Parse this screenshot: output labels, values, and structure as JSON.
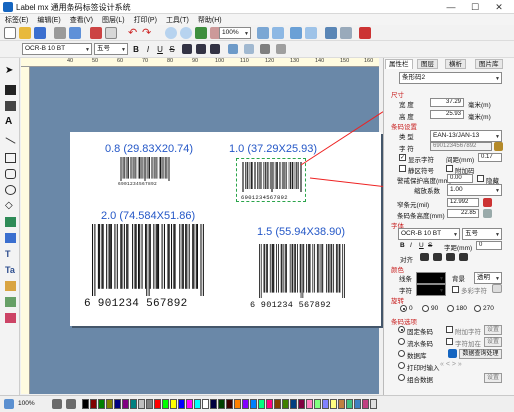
{
  "window": {
    "title": "Label mx 通用条码标签设计系统",
    "minimize": "—",
    "maximize": "☐",
    "close": "✕"
  },
  "menu": [
    "标签(E)",
    "编辑(E)",
    "查看(V)",
    "图层(L)",
    "打印(P)",
    "工具(T)",
    "帮助(H)"
  ],
  "toolbar": {
    "zoom": "100%"
  },
  "format_bar": {
    "font": "OCR-B 10 BT",
    "size": "五号",
    "bold": "B",
    "italic": "I",
    "underline": "U",
    "strike": "S"
  },
  "labels": [
    {
      "text": "0.8 (29.83X20.74)",
      "digits": "6901234567892"
    },
    {
      "text": "1.0 (37.29X25.93)",
      "digits": "6901234567892"
    },
    {
      "text": "2.0 (74.584X51.86)",
      "digits": "6  901234  567892"
    },
    {
      "text": "1.5 (55.94X38.90)",
      "digits": "6  901234  567892"
    }
  ],
  "ruler": [
    "40",
    "50",
    "60",
    "70",
    "80",
    "90",
    "100",
    "110",
    "120",
    "130",
    "140",
    "150",
    "160",
    "170"
  ],
  "status": {
    "zoom": "100%"
  },
  "panel": {
    "tabs": [
      "属性栏",
      "图层",
      "横析",
      "图片库"
    ],
    "object": "条形码2",
    "size_section": "尺寸",
    "width_label": "宽    度",
    "width_value": "37.29",
    "width_unit": "毫米(m)",
    "height_label": "高    度",
    "height_value": "25.93",
    "height_unit": "毫米(m)",
    "barcode_section": "条码设置",
    "type_label": "类    型",
    "type_value": "EAN-13/JAN-13",
    "chars_label": "字    符",
    "chars_value": "6901234567892",
    "show_chars": "显示字符",
    "gap_label": "间距(mm)",
    "gap_value": "0.17",
    "quiet_zone": "静区符号",
    "add_check": "附加码",
    "guard_label": "警戒保护高度(mm)",
    "guard_value": "0.00",
    "hide": "隐藏",
    "scale_label": "缩放系数",
    "scale_value": "1.00",
    "bar_width_label": "窄条元(mil)",
    "bar_width_value": "12.992",
    "bar_height_label": "条码条高度(mm)",
    "bar_height_value": "22.85",
    "font_section": "字体",
    "font_value": "OCR-B 10 BT",
    "font_size": "五号",
    "bold": "B",
    "italic": "I",
    "underline": "U",
    "strike": "S",
    "char_spacing": "字距(mm)",
    "char_spacing_value": "0",
    "align_label": "对齐",
    "color_section": "颜色",
    "line_label": "线条",
    "bg_label": "背景",
    "bg_value": "透明",
    "fontcolor_label": "字符",
    "multicolor": "多彩字符",
    "rotate_section": "旋转",
    "rot": [
      "0",
      "90",
      "180",
      "270"
    ],
    "source_section": "条码选项",
    "src_fixed": "固定条码",
    "src_serial": "流水条码",
    "src_db": "数据库",
    "src_input": "打印时输入",
    "src_combo": "组合数据",
    "var_attr": "附加字符",
    "char_fmt": "字符加在",
    "btn_set": "设置",
    "btn_dbconn": "数据库连接",
    "db_query": "数据查询处理"
  }
}
